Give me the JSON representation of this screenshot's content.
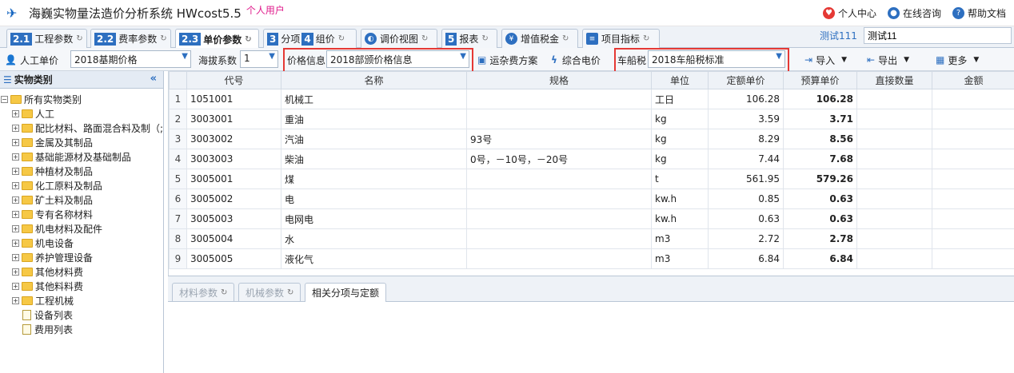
{
  "app": {
    "title": "海巍实物量法造价分析系统 HWcost5.5",
    "user_type": "个人用户"
  },
  "top_links": [
    {
      "label": "个人中心",
      "icon": "user-center-icon"
    },
    {
      "label": "在线咨询",
      "icon": "bell-icon"
    },
    {
      "label": "帮助文档",
      "icon": "help-icon"
    }
  ],
  "tabs": [
    {
      "num": "2.1",
      "label": "工程参数"
    },
    {
      "num": "2.2",
      "label": "费率参数"
    },
    {
      "num": "2.3",
      "label": "单价参数"
    },
    {
      "num": "3",
      "label": "分项"
    },
    {
      "num": "4",
      "label": "组价"
    },
    {
      "label": "调价视图"
    },
    {
      "num": "5",
      "label": "报表"
    },
    {
      "label": "增值税金"
    },
    {
      "label": "项目指标"
    }
  ],
  "project": {
    "label": "测试111",
    "value": "测试11"
  },
  "toolbar": {
    "labor_label": "人工单价",
    "labor_value": "2018基期价格",
    "altitude_label": "海拔系数",
    "altitude_value": "1",
    "price_info_label": "价格信息",
    "price_info_value": "2018部颁价格信息",
    "transport_label": "运杂费方案",
    "electric_label": "综合电价",
    "tax_label": "车船税",
    "tax_value": "2018车船税标准",
    "import_label": "导入",
    "export_label": "导出",
    "more_label": "更多"
  },
  "sidebar": {
    "title": "实物类别",
    "root": "所有实物类别",
    "items": [
      "人工",
      "配比材料、路面混合料及制（;",
      "金属及其制品",
      "基础能源材及基础制品",
      "种植材及制品",
      "化工原料及制品",
      "矿土料及制品",
      "专有名称材料",
      "机电材料及配件",
      "机电设备",
      "养护管理设备",
      "其他材料费",
      "其他料料费",
      "工程机械"
    ],
    "leaves": [
      "设备列表",
      "费用列表"
    ]
  },
  "table": {
    "headers": [
      "",
      "代号",
      "名称",
      "规格",
      "单位",
      "定额单价",
      "预算单价",
      "直接数量",
      "金额"
    ],
    "rows": [
      [
        "1",
        "1051001",
        "机械工",
        "",
        "工日",
        "106.28",
        "106.28"
      ],
      [
        "2",
        "3003001",
        "重油",
        "",
        "kg",
        "3.59",
        "3.71"
      ],
      [
        "3",
        "3003002",
        "汽油",
        "93号",
        "kg",
        "8.29",
        "8.56"
      ],
      [
        "4",
        "3003003",
        "柴油",
        "0号，－10号，－20号",
        "kg",
        "7.44",
        "7.68"
      ],
      [
        "5",
        "3005001",
        "煤",
        "",
        "t",
        "561.95",
        "579.26"
      ],
      [
        "6",
        "3005002",
        "电",
        "",
        "kw.h",
        "0.85",
        "0.63"
      ],
      [
        "7",
        "3005003",
        "电网电",
        "",
        "kw.h",
        "0.63",
        "0.63"
      ],
      [
        "8",
        "3005004",
        "水",
        "",
        "m3",
        "2.72",
        "2.78"
      ],
      [
        "9",
        "3005005",
        "液化气",
        "",
        "m3",
        "6.84",
        "6.84"
      ]
    ]
  },
  "bottom_tabs": [
    "材料参数",
    "机械参数",
    "相关分项与定额"
  ],
  "colors": {
    "accent": "#2d6fc0",
    "highlight_box": "#e53935",
    "user_type": "#e01c8c"
  }
}
